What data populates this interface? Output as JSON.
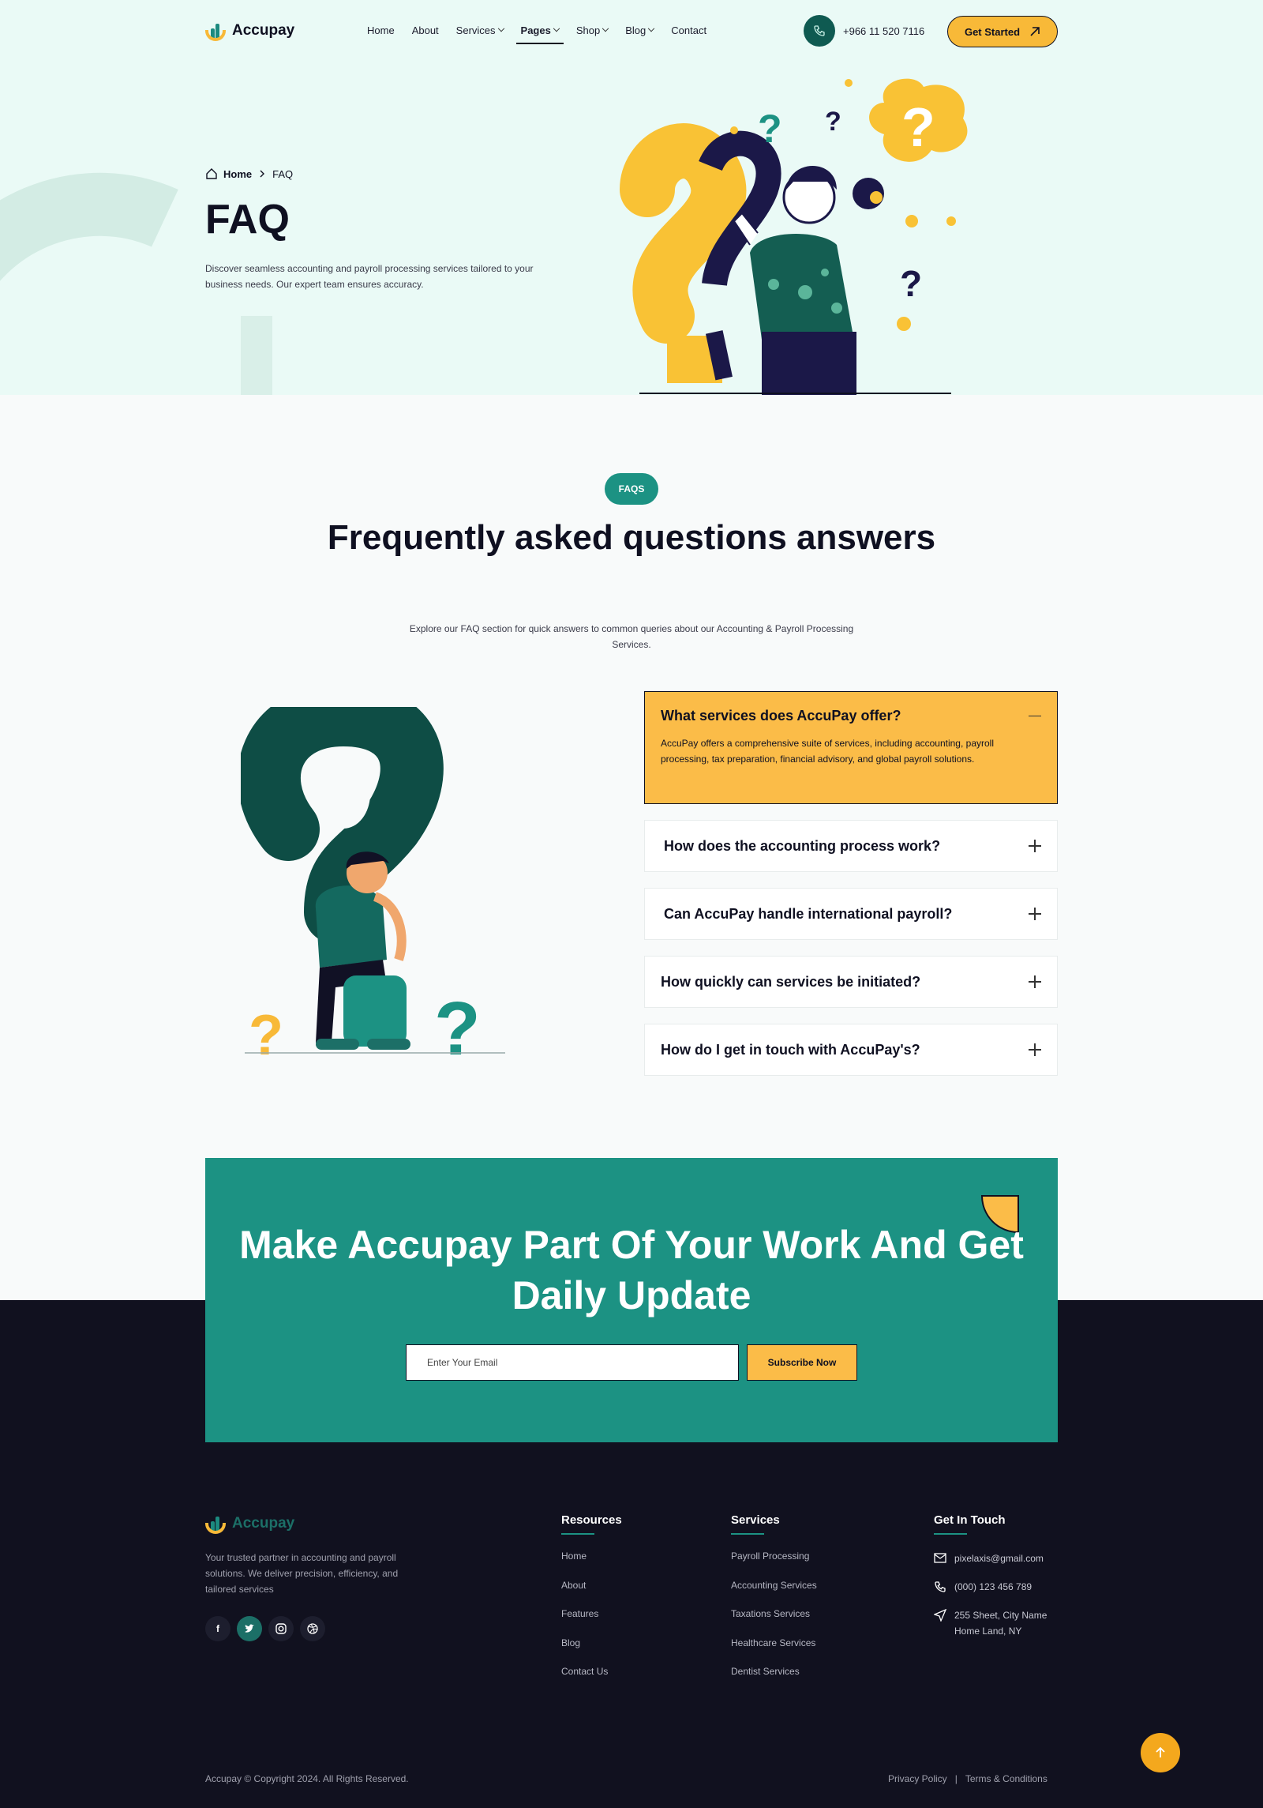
{
  "brand": {
    "name": "Accupay"
  },
  "nav": {
    "items": [
      {
        "label": "Home"
      },
      {
        "label": "About"
      },
      {
        "label": "Services"
      },
      {
        "label": "Pages"
      },
      {
        "label": "Shop"
      },
      {
        "label": "Blog"
      },
      {
        "label": "Contact"
      }
    ],
    "phone": "+966 11 520 7116",
    "cta": "Get Started"
  },
  "hero": {
    "breadcrumb": {
      "home": "Home",
      "current": "FAQ"
    },
    "title": "FAQ",
    "description": "Discover seamless accounting and payroll processing services tailored to your business needs. Our expert team ensures accuracy."
  },
  "faq": {
    "badge": "FAQS",
    "title": "Frequently asked questions answers",
    "subtitle": "Explore our FAQ section for quick answers to common queries about our Accounting & Payroll Processing Services.",
    "items": [
      {
        "question": "What services does AccuPay offer?",
        "answer": "AccuPay offers a comprehensive suite of services, including accounting, payroll processing, tax preparation, financial advisory, and global payroll solutions."
      },
      {
        "question": "How does the accounting process work?"
      },
      {
        "question": "Can AccuPay handle international payroll?"
      },
      {
        "question": "How quickly can services be initiated?"
      },
      {
        "question": "How do I get in touch with AccuPay's?"
      }
    ]
  },
  "newsletter": {
    "title": "Make Accupay Part Of Your Work And Get Daily Update",
    "placeholder": "Enter Your Email",
    "button": "Subscribe Now"
  },
  "footer": {
    "description": "Your trusted partner in accounting and payroll solutions. We deliver precision, efficiency, and tailored services",
    "resources": {
      "title": "Resources",
      "links": [
        "Home",
        "About",
        "Features",
        "Blog",
        "Contact Us"
      ]
    },
    "services": {
      "title": "Services",
      "links": [
        "Payroll Processing",
        "Accounting Services",
        "Taxations Services",
        "Healthcare Services",
        "Dentist Services"
      ]
    },
    "contact": {
      "title": "Get In Touch",
      "email": "pixelaxis@gmail.com",
      "phone": "(000) 123 456 789",
      "address": "255 Sheet, City Name Home Land, NY"
    },
    "copyright": "Accupay © Copyright 2024. All Rights Reserved.",
    "privacy": "Privacy Policy",
    "terms": "Terms & Conditions"
  },
  "colors": {
    "teal": "#1c9283",
    "yellow": "#fbbc48",
    "dark": "#11111f",
    "hero_bg": "#eafaf6"
  }
}
